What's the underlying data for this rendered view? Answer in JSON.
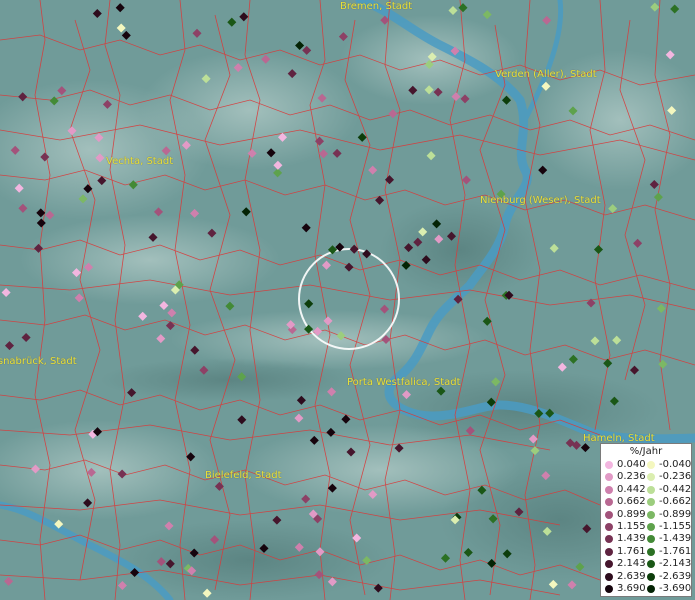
{
  "map": {
    "cities": [
      {
        "name": "Bremen, Stadt"
      },
      {
        "name": "Verden (Aller), Stadt"
      },
      {
        "name": "Vechta, Stadt"
      },
      {
        "name": "Nienburg (Weser), Stadt"
      },
      {
        "name": "Osnabrück, Stadt"
      },
      {
        "name": "Porta Westfalica, Stadt"
      },
      {
        "name": "Hameln, Stadt"
      },
      {
        "name": "Bielefeld, Stadt"
      }
    ]
  },
  "legend": {
    "title": "%/Jahr",
    "positive": [
      {
        "value": "0.040",
        "color": "#f3b6e0"
      },
      {
        "value": "0.236",
        "color": "#e29ac6"
      },
      {
        "value": "0.442",
        "color": "#cf80ad"
      },
      {
        "value": "0.662",
        "color": "#b96892"
      },
      {
        "value": "0.899",
        "color": "#a3537b"
      },
      {
        "value": "1.155",
        "color": "#8d4166"
      },
      {
        "value": "1.439",
        "color": "#773253"
      },
      {
        "value": "1.761",
        "color": "#5f2340"
      },
      {
        "value": "2.143",
        "color": "#46162d"
      },
      {
        "value": "2.639",
        "color": "#2e0c1d"
      },
      {
        "value": "3.690",
        "color": "#16040d"
      }
    ],
    "negative": [
      {
        "value": "-0.040",
        "color": "#f4f7bf"
      },
      {
        "value": "-0.236",
        "color": "#dbeeb0"
      },
      {
        "value": "-0.442",
        "color": "#bcdf98"
      },
      {
        "value": "-0.662",
        "color": "#9ccd7e"
      },
      {
        "value": "-0.899",
        "color": "#7cb864"
      },
      {
        "value": "-1.155",
        "color": "#5ea24c"
      },
      {
        "value": "-1.439",
        "color": "#438a36"
      },
      {
        "value": "-1.761",
        "color": "#2c7124"
      },
      {
        "value": "-2.143",
        "color": "#1a5716"
      },
      {
        "value": "-2.639",
        "color": "#0d3d0b"
      },
      {
        "value": "-3.690",
        "color": "#042304"
      }
    ]
  }
}
